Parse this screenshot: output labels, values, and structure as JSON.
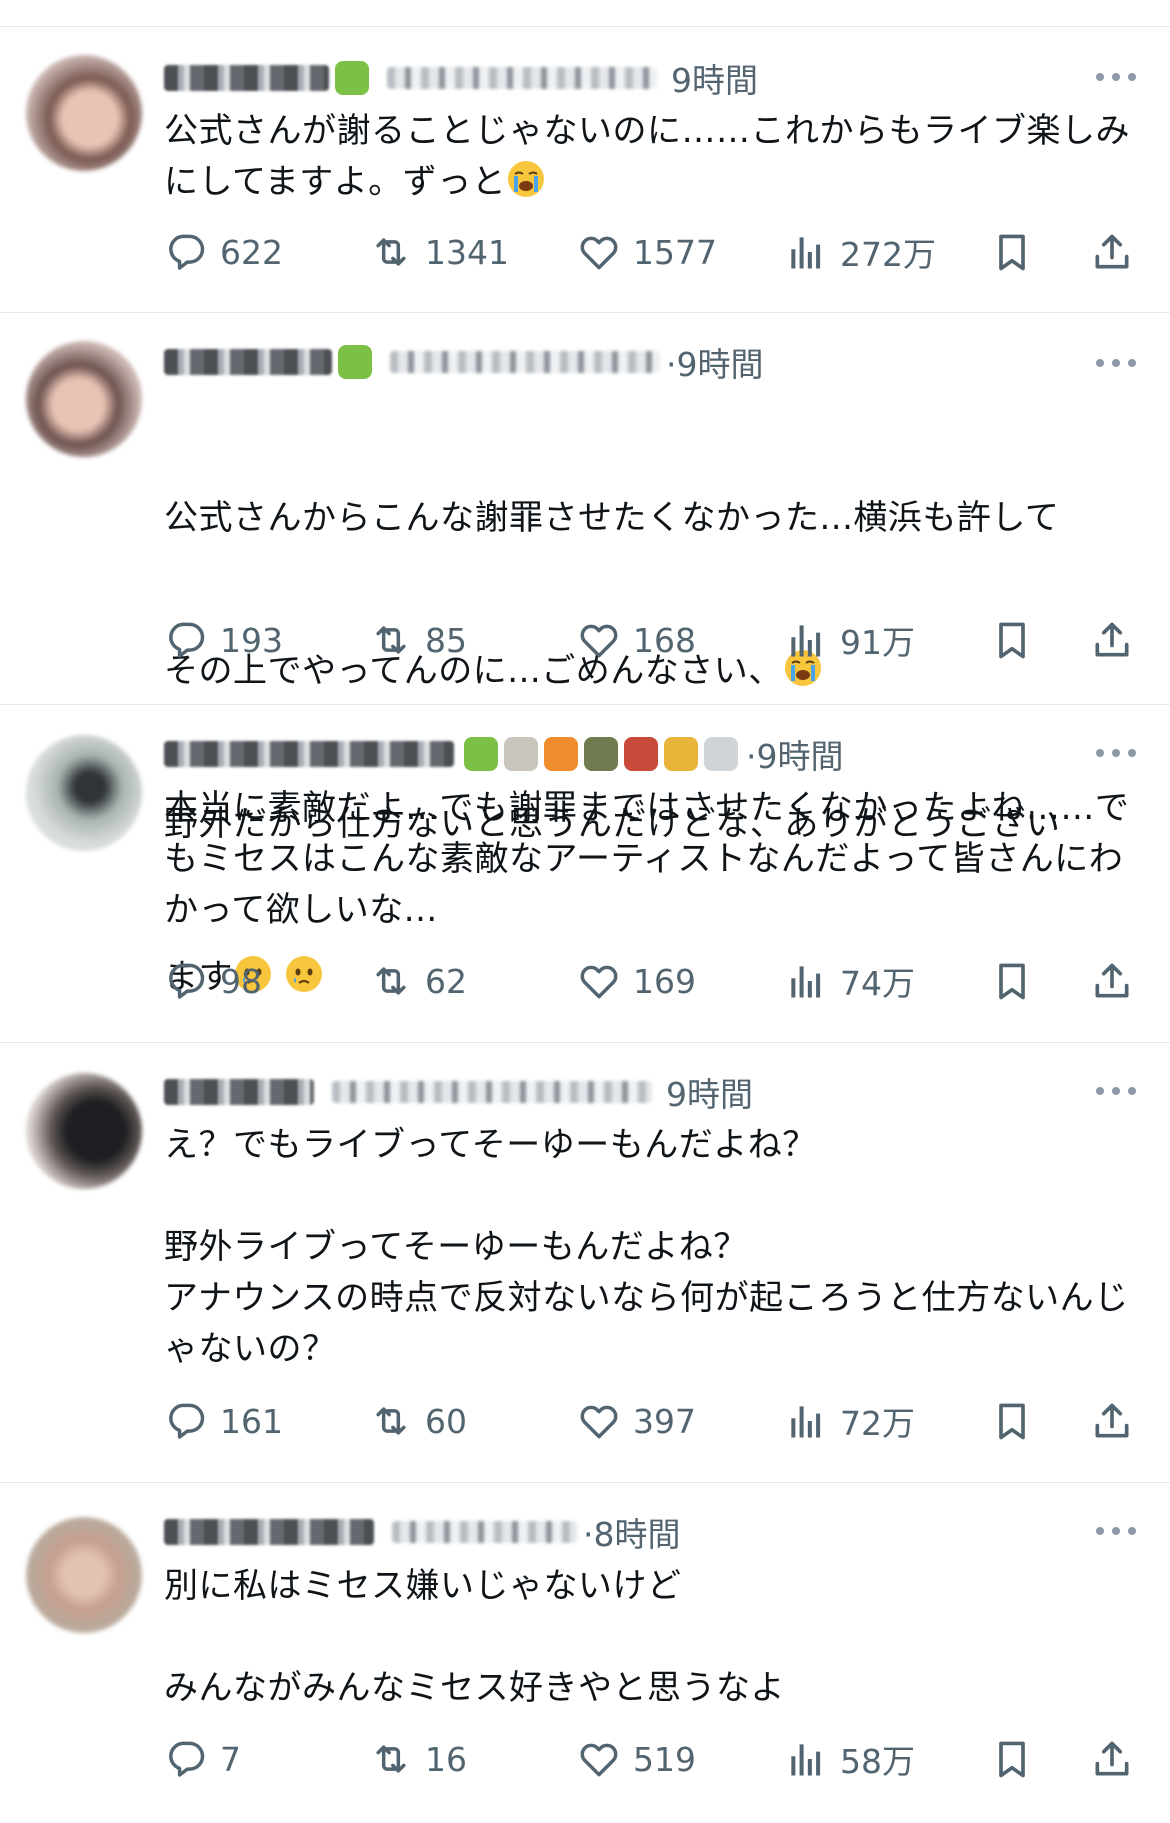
{
  "tweets": [
    {
      "time": "9時間",
      "text": "公式さんが謝ることじゃないのに……これからもライブ楽しみにしてますよ。ずっと",
      "emojis": [
        "loudly-crying-face-emoji"
      ],
      "reply_count": "622",
      "retweet_count": "1341",
      "like_count": "1577",
      "view_count": "272万"
    },
    {
      "time": "·9時間",
      "text_line1": "公式さんからこんな謝罪させたくなかった...横浜も許して",
      "text_line2": "その上でやってんのに...ごめんなさい、",
      "text_line3": "野外だから仕方ないと思うんだけどな、ありがとうござい",
      "text_line4": "ます",
      "emojis": [
        "loudly-crying-face-emoji",
        "face-holding-back-tears-emoji",
        "face-holding-back-tears-emoji"
      ],
      "reply_count": "193",
      "retweet_count": "85",
      "like_count": "168",
      "view_count": "91万"
    },
    {
      "time": "·9時間",
      "text": "本当に素敵だよ...でも謝罪まではさせたくなかったよね……でもミセスはこんな素敵なアーティストなんだよって皆さんにわかって欲しいな...",
      "reply_count": "98",
      "retweet_count": "62",
      "like_count": "169",
      "view_count": "74万"
    },
    {
      "time": "9時間",
      "text": "え？でもライブってそーゆーもんだよね？\n\n野外ライブってそーゆーもんだよね？\nアナウンスの時点で反対ないなら何が起ころうと仕方ないんじゃないの？",
      "reply_count": "161",
      "retweet_count": "60",
      "like_count": "397",
      "view_count": "72万"
    },
    {
      "time": "·8時間",
      "text": "別に私はミセス嫌いじゃないけど\n\nみんながみんなミセス好きやと思うなよ",
      "reply_count": "7",
      "retweet_count": "16",
      "like_count": "519",
      "view_count": "58万"
    }
  ],
  "colors": {
    "text": "#0f1419",
    "muted": "#536471",
    "divider": "#e6e9eb"
  }
}
